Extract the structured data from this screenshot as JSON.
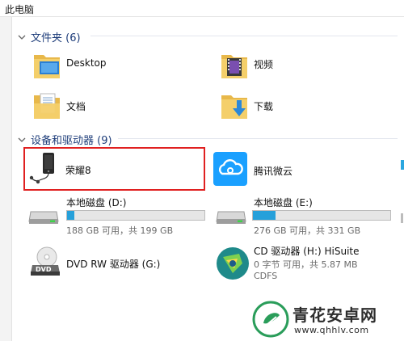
{
  "window": {
    "title": "此电脑"
  },
  "folders_group": {
    "header": "文件夹 (6)",
    "items": [
      {
        "label": "Desktop",
        "icon": "desktop-folder-icon"
      },
      {
        "label": "视频",
        "icon": "videos-folder-icon"
      },
      {
        "label": "文档",
        "icon": "documents-folder-icon"
      },
      {
        "label": "下载",
        "icon": "downloads-folder-icon"
      }
    ]
  },
  "devices_group": {
    "header": "设备和驱动器 (9)",
    "items": [
      {
        "label": "荣耀8",
        "icon": "phone-icon",
        "highlighted": true
      },
      {
        "label": "腾讯微云",
        "icon": "weiyun-cloud-icon"
      },
      {
        "label": "本地磁盘 (D:)",
        "icon": "hard-drive-icon",
        "usage_text": "188 GB 可用，共 199 GB",
        "used_fraction": 0.055
      },
      {
        "label": "本地磁盘 (E:)",
        "icon": "hard-drive-icon",
        "usage_text": "276 GB 可用，共 331 GB",
        "used_fraction": 0.166
      },
      {
        "label": "DVD RW 驱动器 (G:)",
        "icon": "dvd-drive-icon"
      },
      {
        "label": "CD 驱动器 (H:) HiSuite",
        "icon": "hisuite-cd-icon",
        "sub1": "0 字节 可用，共 5.87 MB",
        "sub2": "CDFS"
      }
    ]
  },
  "watermark": {
    "text": "青花安卓网",
    "url": "www.qhhlv.com"
  },
  "colors": {
    "accent": "#26a0da",
    "highlight": "#e02020",
    "group_header": "#1e3d7a"
  }
}
